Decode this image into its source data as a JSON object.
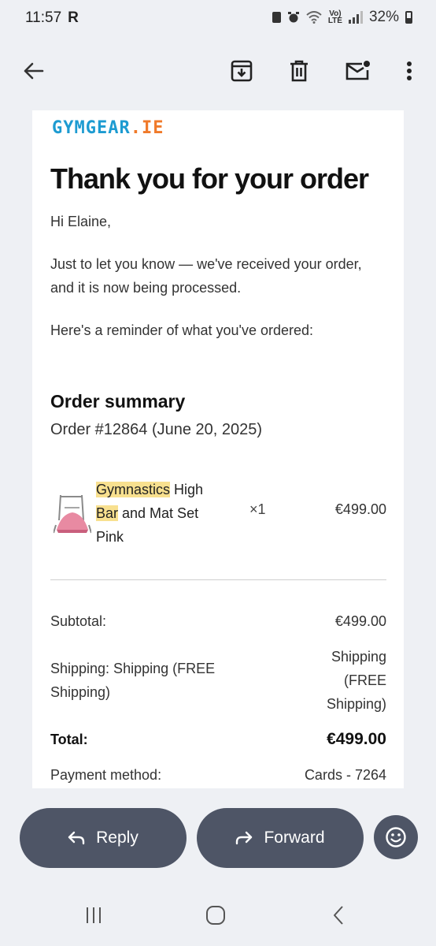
{
  "status_bar": {
    "time": "11:57",
    "carrier_badge": "R",
    "volte_top": "Vo)",
    "volte_bottom": "LTE",
    "battery": "32%"
  },
  "toolbar": {
    "icons": [
      "back-arrow-icon",
      "archive-icon",
      "trash-icon",
      "mark-unread-icon",
      "more-vert-icon"
    ]
  },
  "email": {
    "logo_main": "GYMGEAR",
    "logo_tld": ".IE",
    "title": "Thank you for your order",
    "greeting": "Hi Elaine,",
    "body_line1": "Just to let you know — we've received your order,",
    "body_line2": "and it is now being processed.",
    "reminder": "Here's a reminder of what you've ordered:",
    "summary_heading": "Order summary",
    "order_number": "Order #12864 (June 20, 2025)",
    "item": {
      "name_hl1": "Gymnastics",
      "name_rest1": " High",
      "name_hl2": "Bar",
      "name_rest2": " and Mat Set",
      "name_line3": "Pink",
      "quantity": "×1",
      "price": "€499.00"
    },
    "totals": {
      "subtotal_label": "Subtotal:",
      "subtotal_value": "€499.00",
      "shipping_label_1": "Shipping: Shipping (FREE",
      "shipping_label_2": "Shipping)",
      "shipping_value_1": "Shipping",
      "shipping_value_2": "(FREE",
      "shipping_value_3": "Shipping)",
      "total_label": "Total:",
      "total_value": "€499.00",
      "payment_label": "Payment method:",
      "payment_value": "Cards - 7264"
    },
    "accent_colors": {
      "logo_blue": "#1d9bd1",
      "logo_orange": "#f07a2a",
      "highlight": "#f8e08f"
    }
  },
  "actions": {
    "reply_label": "Reply",
    "forward_label": "Forward"
  }
}
